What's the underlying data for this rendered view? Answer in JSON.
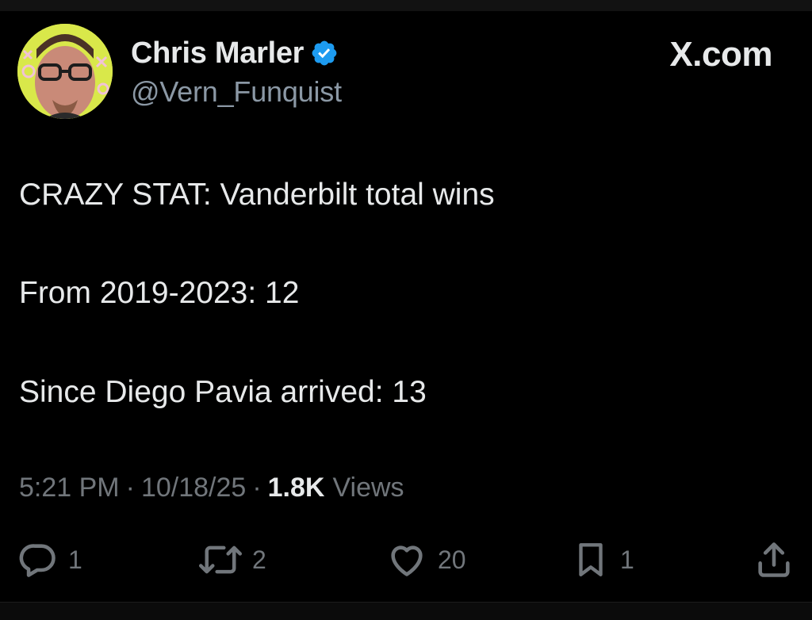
{
  "header": {
    "display_name": "Chris Marler",
    "handle": "@Vern_Funquist",
    "verified_badge": "verified-badge-icon",
    "brand": "X.com"
  },
  "tweet": {
    "line_1": "CRAZY STAT: Vanderbilt total wins",
    "line_2": "From 2019-2023: 12",
    "line_3": "Since Diego Pavia arrived: 13"
  },
  "meta": {
    "time": "5:21 PM",
    "separator": "·",
    "date": "10/18/25",
    "views_count": "1.8K",
    "views_label": "Views"
  },
  "actions": {
    "reply": {
      "icon": "reply-icon",
      "count": "1"
    },
    "retweet": {
      "icon": "retweet-icon",
      "count": "2"
    },
    "like": {
      "icon": "heart-icon",
      "count": "20"
    },
    "bookmark": {
      "icon": "bookmark-icon",
      "count": "1"
    },
    "share": {
      "icon": "share-icon"
    }
  },
  "colors": {
    "background": "#000000",
    "text_primary": "#e7e9ea",
    "text_secondary": "#71767b",
    "verified_blue": "#1d9bf0",
    "avatar_bg": "#d9e84a"
  }
}
